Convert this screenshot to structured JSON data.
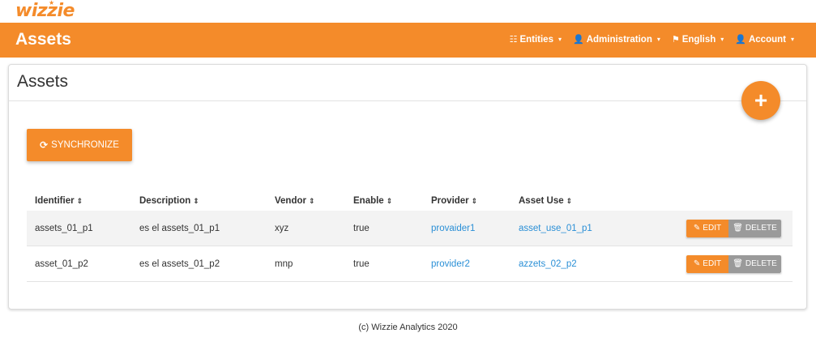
{
  "brand": {
    "logo": "wizzie",
    "logo_star": "★"
  },
  "navbar": {
    "title": "Assets",
    "menu": [
      {
        "icon": "☷",
        "label": "Entities",
        "caret": "▾"
      },
      {
        "icon": "👤",
        "label": "Administration",
        "caret": "▾"
      },
      {
        "icon": "⚑",
        "label": "English",
        "caret": "▾"
      },
      {
        "icon": "👤",
        "label": "Account",
        "caret": "▾"
      }
    ]
  },
  "panel": {
    "title": "Assets",
    "fab_label": "+",
    "sync_icon": "⟳",
    "sync_label": "SYNCHRONIZE"
  },
  "table": {
    "sort_icon": "⇕",
    "headers": [
      "Identifier",
      "Description",
      "Vendor",
      "Enable",
      "Provider",
      "Asset Use"
    ],
    "rows": [
      {
        "identifier": "assets_01_p1",
        "description": "es el assets_01_p1",
        "vendor": "xyz",
        "enable": "true",
        "provider": "provaider1",
        "asset_use": "asset_use_01_p1"
      },
      {
        "identifier": "asset_01_p2",
        "description": "es el assets_01_p2",
        "vendor": "mnp",
        "enable": "true",
        "provider": "provider2",
        "asset_use": "azzets_02_p2"
      }
    ],
    "edit_icon": "✎",
    "edit_label": "EDIT",
    "delete_icon": "🗑",
    "delete_label": "DELETE"
  },
  "footer": {
    "text": "(c) Wizzie Analytics 2020"
  },
  "colors": {
    "accent": "#f48b2a",
    "link": "#2a8fd6",
    "delete": "#9a9a9a"
  }
}
